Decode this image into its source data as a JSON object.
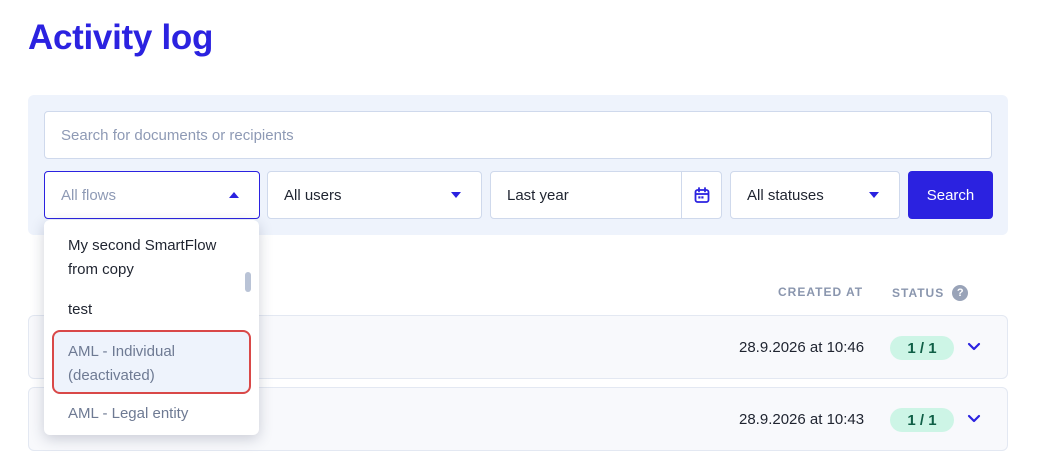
{
  "header": {
    "title": "Activity log"
  },
  "filters": {
    "search_placeholder": "Search for documents or recipients",
    "flows_value": "All flows",
    "users_value": "All users",
    "date_value": "Last year",
    "status_value": "All statuses",
    "search_button_label": "Search"
  },
  "flows_dropdown": {
    "items": [
      {
        "label": "My second SmartFlow from copy"
      },
      {
        "label": "test"
      },
      {
        "label": "AML - Individual (deactivated)"
      },
      {
        "label": "AML - Legal entity"
      }
    ]
  },
  "table": {
    "columns": {
      "created_at": "CREATED AT",
      "status": "STATUS"
    },
    "help_icon": "?",
    "rows": [
      {
        "created_at": "28.9.2026 at 10:46",
        "status": "1 / 1"
      },
      {
        "created_at": "28.9.2026 at 10:43",
        "status": "1 / 1"
      }
    ]
  },
  "icons": {
    "calendar": "calendar-icon",
    "caret": "caret-down-icon",
    "expand": "chevron-down-icon",
    "help": "help-icon"
  },
  "colors": {
    "accent": "#2b22e0",
    "panel_bg": "#eef3fc",
    "badge_bg": "#cdf5e6",
    "highlight_border": "#d94848"
  }
}
